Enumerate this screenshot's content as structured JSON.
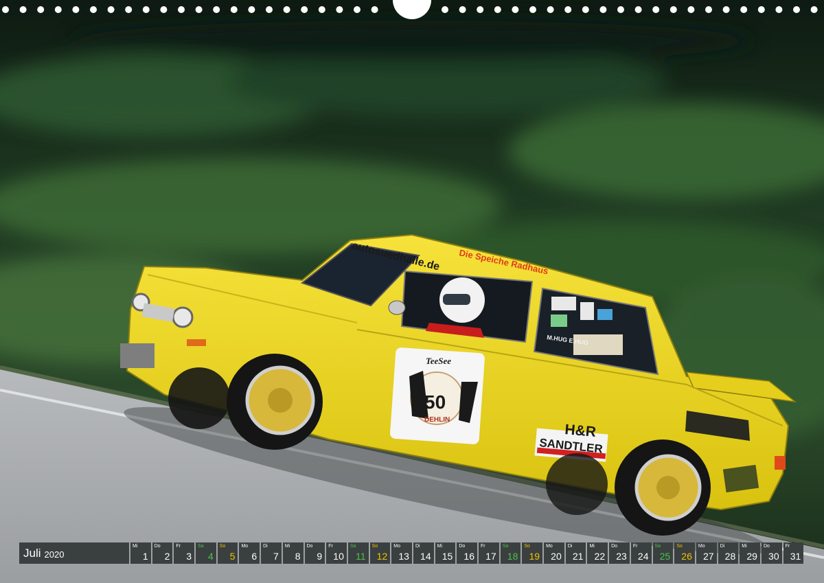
{
  "calendar": {
    "month": "Juli",
    "year": "2020",
    "days": [
      {
        "wd": "Mi",
        "n": "1",
        "t": "w"
      },
      {
        "wd": "Do",
        "n": "2",
        "t": "w"
      },
      {
        "wd": "Fr",
        "n": "3",
        "t": "w"
      },
      {
        "wd": "Sa",
        "n": "4",
        "t": "sa"
      },
      {
        "wd": "So",
        "n": "5",
        "t": "so"
      },
      {
        "wd": "Mo",
        "n": "6",
        "t": "w"
      },
      {
        "wd": "Di",
        "n": "7",
        "t": "w"
      },
      {
        "wd": "Mi",
        "n": "8",
        "t": "w"
      },
      {
        "wd": "Do",
        "n": "9",
        "t": "w"
      },
      {
        "wd": "Fr",
        "n": "10",
        "t": "w"
      },
      {
        "wd": "Sa",
        "n": "11",
        "t": "sa"
      },
      {
        "wd": "So",
        "n": "12",
        "t": "so"
      },
      {
        "wd": "Mo",
        "n": "13",
        "t": "w"
      },
      {
        "wd": "Di",
        "n": "14",
        "t": "w"
      },
      {
        "wd": "Mi",
        "n": "15",
        "t": "w"
      },
      {
        "wd": "Do",
        "n": "16",
        "t": "w"
      },
      {
        "wd": "Fr",
        "n": "17",
        "t": "w"
      },
      {
        "wd": "Sa",
        "n": "18",
        "t": "sa"
      },
      {
        "wd": "So",
        "n": "19",
        "t": "so"
      },
      {
        "wd": "Mo",
        "n": "20",
        "t": "w"
      },
      {
        "wd": "Di",
        "n": "21",
        "t": "w"
      },
      {
        "wd": "Mi",
        "n": "22",
        "t": "w"
      },
      {
        "wd": "Do",
        "n": "23",
        "t": "w"
      },
      {
        "wd": "Fr",
        "n": "24",
        "t": "w"
      },
      {
        "wd": "Sa",
        "n": "25",
        "t": "sa"
      },
      {
        "wd": "So",
        "n": "26",
        "t": "so"
      },
      {
        "wd": "Mo",
        "n": "27",
        "t": "w"
      },
      {
        "wd": "Di",
        "n": "28",
        "t": "w"
      },
      {
        "wd": "Mi",
        "n": "29",
        "t": "w"
      },
      {
        "wd": "Do",
        "n": "30",
        "t": "w"
      },
      {
        "wd": "Fr",
        "n": "31",
        "t": "w"
      }
    ]
  },
  "car": {
    "windshield_banner": "autosuedhalle.de",
    "roof_text": "Die Speiche Radhaus",
    "door_number": "50",
    "door_brand": "TeeSee",
    "door_city": "DEHLIN",
    "sponsor_1": "H&R",
    "sponsor_2": "SANDTLER",
    "driver_names": "M.HUG E.HUG"
  },
  "colors": {
    "car_body": "#efd81c",
    "saturday": "#4ec14e",
    "sunday": "#f0c400",
    "calendar_cell": "#3a3f3f"
  }
}
